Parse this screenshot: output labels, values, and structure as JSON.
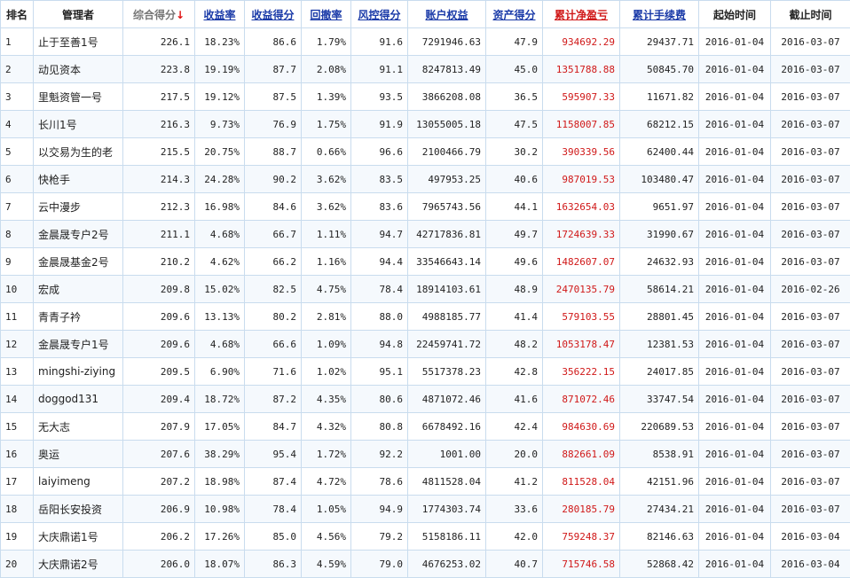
{
  "headers": [
    {
      "label": "排名",
      "name": "col-rank",
      "link": false
    },
    {
      "label": "管理者",
      "name": "col-manager",
      "link": false
    },
    {
      "label": "综合得分",
      "name": "col-total-score",
      "link": false,
      "sorted": true,
      "sort_arrow": "↓"
    },
    {
      "label": "收益率",
      "name": "col-return-rate",
      "link": true
    },
    {
      "label": "收益得分",
      "name": "col-return-score",
      "link": true
    },
    {
      "label": "回撤率",
      "name": "col-drawdown-rate",
      "link": true
    },
    {
      "label": "风控得分",
      "name": "col-risk-score",
      "link": true
    },
    {
      "label": "账户权益",
      "name": "col-equity",
      "link": true
    },
    {
      "label": "资产得分",
      "name": "col-asset-score",
      "link": true
    },
    {
      "label": "累计净盈亏",
      "name": "col-net-pnl",
      "link": true,
      "red": true
    },
    {
      "label": "累计手续费",
      "name": "col-fees",
      "link": true
    },
    {
      "label": "起始时间",
      "name": "col-start-date",
      "link": false
    },
    {
      "label": "截止时间",
      "name": "col-end-date",
      "link": false
    }
  ],
  "colors": {
    "accent_link": "#1a3aa8",
    "pnl_red": "#d01818",
    "sort_arrow": "#e01010"
  },
  "rows": [
    [
      "1",
      "止于至善1号",
      "226.1",
      "18.23%",
      "86.6",
      "1.79%",
      "91.6",
      "7291946.63",
      "47.9",
      "934692.29",
      "29437.71",
      "2016-01-04",
      "2016-03-07"
    ],
    [
      "2",
      "动见资本",
      "223.8",
      "19.19%",
      "87.7",
      "2.08%",
      "91.1",
      "8247813.49",
      "45.0",
      "1351788.88",
      "50845.70",
      "2016-01-04",
      "2016-03-07"
    ],
    [
      "3",
      "里魁资管一号",
      "217.5",
      "19.12%",
      "87.5",
      "1.39%",
      "93.5",
      "3866208.08",
      "36.5",
      "595907.33",
      "11671.82",
      "2016-01-04",
      "2016-03-07"
    ],
    [
      "4",
      "长川1号",
      "216.3",
      "9.73%",
      "76.9",
      "1.75%",
      "91.9",
      "13055005.18",
      "47.5",
      "1158007.85",
      "68212.15",
      "2016-01-04",
      "2016-03-07"
    ],
    [
      "5",
      "以交易为生的老",
      "215.5",
      "20.75%",
      "88.7",
      "0.66%",
      "96.6",
      "2100466.79",
      "30.2",
      "390339.56",
      "62400.44",
      "2016-01-04",
      "2016-03-07"
    ],
    [
      "6",
      "快枪手",
      "214.3",
      "24.28%",
      "90.2",
      "3.62%",
      "83.5",
      "497953.25",
      "40.6",
      "987019.53",
      "103480.47",
      "2016-01-04",
      "2016-03-07"
    ],
    [
      "7",
      "云中漫步",
      "212.3",
      "16.98%",
      "84.6",
      "3.62%",
      "83.6",
      "7965743.56",
      "44.1",
      "1632654.03",
      "9651.97",
      "2016-01-04",
      "2016-03-07"
    ],
    [
      "8",
      "金晨晟专户2号",
      "211.1",
      "4.68%",
      "66.7",
      "1.11%",
      "94.7",
      "42717836.81",
      "49.7",
      "1724639.33",
      "31990.67",
      "2016-01-04",
      "2016-03-07"
    ],
    [
      "9",
      "金晨晟基金2号",
      "210.2",
      "4.62%",
      "66.2",
      "1.16%",
      "94.4",
      "33546643.14",
      "49.6",
      "1482607.07",
      "24632.93",
      "2016-01-04",
      "2016-03-07"
    ],
    [
      "10",
      "宏成",
      "209.8",
      "15.02%",
      "82.5",
      "4.75%",
      "78.4",
      "18914103.61",
      "48.9",
      "2470135.79",
      "58614.21",
      "2016-01-04",
      "2016-02-26"
    ],
    [
      "11",
      "青青子衿",
      "209.6",
      "13.13%",
      "80.2",
      "2.81%",
      "88.0",
      "4988185.77",
      "41.4",
      "579103.55",
      "28801.45",
      "2016-01-04",
      "2016-03-07"
    ],
    [
      "12",
      "金晨晟专户1号",
      "209.6",
      "4.68%",
      "66.6",
      "1.09%",
      "94.8",
      "22459741.72",
      "48.2",
      "1053178.47",
      "12381.53",
      "2016-01-04",
      "2016-03-07"
    ],
    [
      "13",
      "mingshi-ziying",
      "209.5",
      "6.90%",
      "71.6",
      "1.02%",
      "95.1",
      "5517378.23",
      "42.8",
      "356222.15",
      "24017.85",
      "2016-01-04",
      "2016-03-07"
    ],
    [
      "14",
      "doggod131",
      "209.4",
      "18.72%",
      "87.2",
      "4.35%",
      "80.6",
      "4871072.46",
      "41.6",
      "871072.46",
      "33747.54",
      "2016-01-04",
      "2016-03-07"
    ],
    [
      "15",
      "无大志",
      "207.9",
      "17.05%",
      "84.7",
      "4.32%",
      "80.8",
      "6678492.16",
      "42.4",
      "984630.69",
      "220689.53",
      "2016-01-04",
      "2016-03-07"
    ],
    [
      "16",
      "奥运",
      "207.6",
      "38.29%",
      "95.4",
      "1.72%",
      "92.2",
      "1001.00",
      "20.0",
      "882661.09",
      "8538.91",
      "2016-01-04",
      "2016-03-07"
    ],
    [
      "17",
      "laiyimeng",
      "207.2",
      "18.98%",
      "87.4",
      "4.72%",
      "78.6",
      "4811528.04",
      "41.2",
      "811528.04",
      "42151.96",
      "2016-01-04",
      "2016-03-07"
    ],
    [
      "18",
      "岳阳长安投资",
      "206.9",
      "10.98%",
      "78.4",
      "1.05%",
      "94.9",
      "1774303.74",
      "33.6",
      "280185.79",
      "27434.21",
      "2016-01-04",
      "2016-03-07"
    ],
    [
      "19",
      "大庆鼎诺1号",
      "206.2",
      "17.26%",
      "85.0",
      "4.56%",
      "79.2",
      "5158186.11",
      "42.0",
      "759248.37",
      "82146.63",
      "2016-01-04",
      "2016-03-04"
    ],
    [
      "20",
      "大庆鼎诺2号",
      "206.0",
      "18.07%",
      "86.3",
      "4.59%",
      "79.0",
      "4676253.02",
      "40.7",
      "715746.58",
      "52868.42",
      "2016-01-04",
      "2016-03-04"
    ]
  ]
}
